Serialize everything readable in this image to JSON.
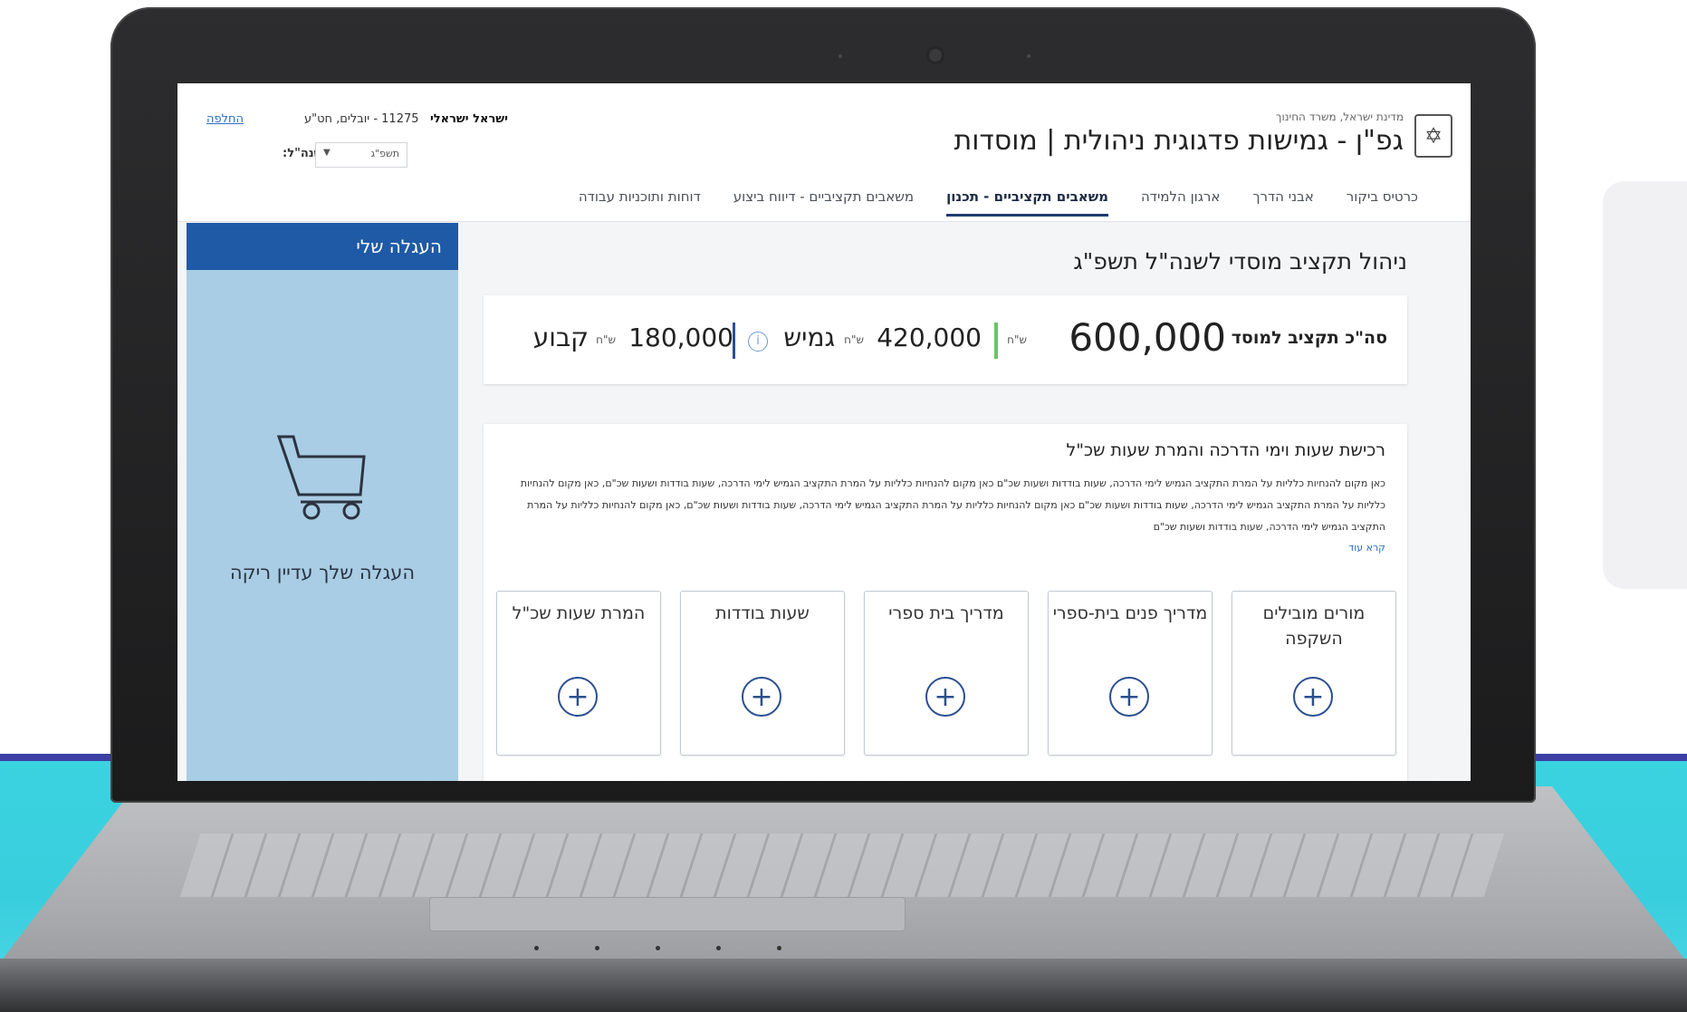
{
  "header": {
    "ministry": "מדינת ישראל, משרד החינוך",
    "app_title": "גפ\"ן - גמישות פדגוגית ניהולית | מוסדות",
    "user_name": "ישראל ישראלי",
    "user_detail": "11275 - יובלים, חט\"ע",
    "help": "החלפה",
    "year_label": "שנה\"ל:",
    "year_value": "תשפ\"ג"
  },
  "nav": {
    "tabs": [
      {
        "label": "כרטיס ביקור",
        "active": false
      },
      {
        "label": "אבני הדרך",
        "active": false
      },
      {
        "label": "ארגון הלמידה",
        "active": false
      },
      {
        "label": "משאבים תקציביים - תכנון",
        "active": true
      },
      {
        "label": "משאבים תקציביים - דיווח ביצוע",
        "active": false
      },
      {
        "label": "דוחות ותוכניות עבודה",
        "active": false
      }
    ]
  },
  "sidebar": {
    "title": "העגלה שלי",
    "empty_text": "העגלה שלך עדיין ריקה",
    "icon": "cart-icon"
  },
  "main": {
    "heading": "ניהול תקציב מוסדי לשנה\"ל תשפ\"ג",
    "budget": {
      "total_label": "סה\"כ תקציב למוסד",
      "total_value": "600,000",
      "currency": "ש\"ח",
      "flexible_value": "420,000",
      "flexible_label": "גמיש",
      "fixed_value": "180,000",
      "fixed_label": "קבוע",
      "info_icon": "info-icon",
      "colors": {
        "flexible": "#6cc36a",
        "fixed": "#2b4f8f"
      }
    },
    "purchase": {
      "title": "רכישת שעות וימי הדרכה והמרת שעות שכ\"ל",
      "description": "כאן מקום להנחיות כלליות על המרת התקציב הגמיש לימי הדרכה, שעות בודדות ושעות שכ\"ם כאן מקום להנחיות כלליות על המרת התקציב הגמיש לימי הדרכה, שעות בודדות ושעות שכ\"ם, כאן מקום להנחיות כלליות על המרת התקציב הגמיש לימי הדרכה, שעות בודדות ושעות שכ\"ם כאן מקום להנחיות כלליות על המרת התקציב הגמיש לימי הדרכה, שעות בודדות ושעות שכ\"ם, כאן מקום להנחיות כלליות על המרת התקציב הגמיש לימי הדרכה, שעות בודדות ושעות שכ\"ם",
      "read_more": "קרא עוד",
      "cards": [
        {
          "label": "מורים מובילים השקפה"
        },
        {
          "label": "מדריך פנים בית-ספרי"
        },
        {
          "label": "מדריך בית ספרי"
        },
        {
          "label": "שעות בודדות"
        },
        {
          "label": "המרת שעות שכ\"ל"
        }
      ],
      "plus": "+"
    }
  },
  "colors": {
    "brand_blue": "#1f5aa6",
    "sidebar_bg": "#a9cde4",
    "accent": "#2b4f8f"
  }
}
